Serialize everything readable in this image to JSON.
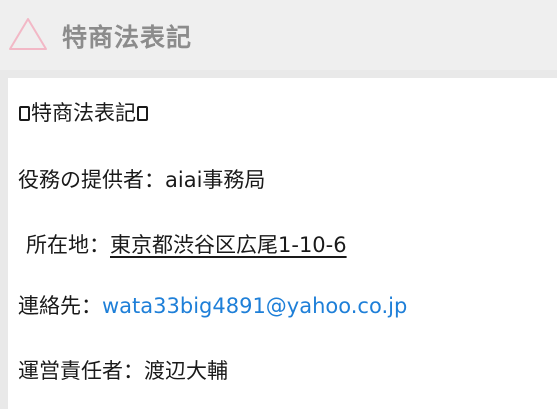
{
  "header": {
    "title": "特商法表記",
    "icon": "triangle-outline-icon",
    "accent_color": "#f2b8c6"
  },
  "content": {
    "heading": "特商法表記",
    "provider_label": "役務の提供者：",
    "provider_value": "aiai事務局",
    "address_label": "所在地：",
    "address_value": "東京都渋谷区広尾1-10-6",
    "contact_label": "連絡先：",
    "contact_value": "wata33big4891@yahoo.co.jp",
    "manager_label": "運営責任者：",
    "manager_value": "渡辺大輔"
  },
  "colors": {
    "link": "#1e7fd8",
    "title": "#8c8c8c"
  }
}
